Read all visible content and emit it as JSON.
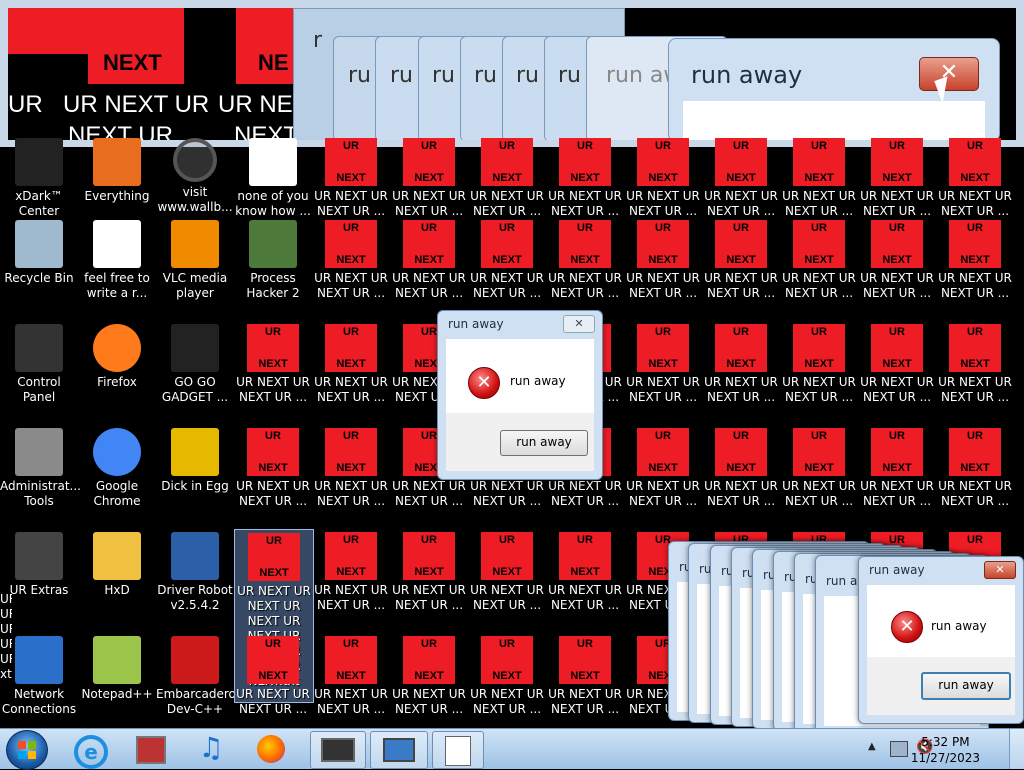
{
  "magnifier": {
    "tile_text": "NEXT",
    "line1": "UR NEXT UR",
    "line2": "UR NEXT UR",
    "line3": "NEXT UR",
    "dialog_title": "run away"
  },
  "desktop_icons": [
    {
      "label": "xDark™\nCenter",
      "icon": "xdark-icon"
    },
    {
      "label": "Everything",
      "icon": "everything-icon"
    },
    {
      "label": "visit\nwww.wallb...",
      "icon": "magnifier-icon"
    },
    {
      "label": "none of you\nknow how ...",
      "icon": "text-file-icon"
    },
    {
      "label": "Recycle Bin",
      "icon": "recycle-bin-icon"
    },
    {
      "label": "feel free to\nwrite a r...",
      "icon": "text-file-icon"
    },
    {
      "label": "VLC media\nplayer",
      "icon": "vlc-icon"
    },
    {
      "label": "Process\nHacker 2",
      "icon": "process-hacker-icon"
    },
    {
      "label": "Control Panel",
      "icon": "control-panel-icon"
    },
    {
      "label": "Firefox",
      "icon": "firefox-icon"
    },
    {
      "label": "GO GO\nGADGET ...",
      "icon": "gadget-icon"
    },
    {
      "label": "Administrat...\nTools",
      "icon": "admin-tools-icon"
    },
    {
      "label": "Google\nChrome",
      "icon": "chrome-icon"
    },
    {
      "label": "Dick in Egg",
      "icon": "egg-icon"
    },
    {
      "label": "UR Extras",
      "icon": "folder-icon"
    },
    {
      "label": "HxD",
      "icon": "hxd-icon"
    },
    {
      "label": "Driver Robot\nv2.5.4.2",
      "icon": "driver-robot-icon"
    },
    {
      "label": "Network\nConnections",
      "icon": "network-icon"
    },
    {
      "label": "Notepad++",
      "icon": "notepadpp-icon"
    },
    {
      "label": "Embarcadero\nDev-C++",
      "icon": "devcpp-icon"
    }
  ],
  "ur_icons": {
    "tile_top": "UR",
    "tile_bottom": "NEXT",
    "label": "UR NEXT UR\nNEXT UR ...",
    "selected_label": "UR NEXT UR\nNEXT UR\nNEXT UR\nNEXT UR\nNEXT UR\nNEXT UR\nNEXT.txt",
    "left_edge": "UR\nUR\nUR\nUR\nUR\nxt"
  },
  "dialog_center": {
    "title": "run away",
    "message": "run away",
    "button": "run away"
  },
  "dialog_stack": {
    "title": "run away",
    "title_short": "ru",
    "message": "run away",
    "button": "run away"
  },
  "taskbar": {
    "time": "5:32 PM",
    "date": "11/27/2023"
  }
}
